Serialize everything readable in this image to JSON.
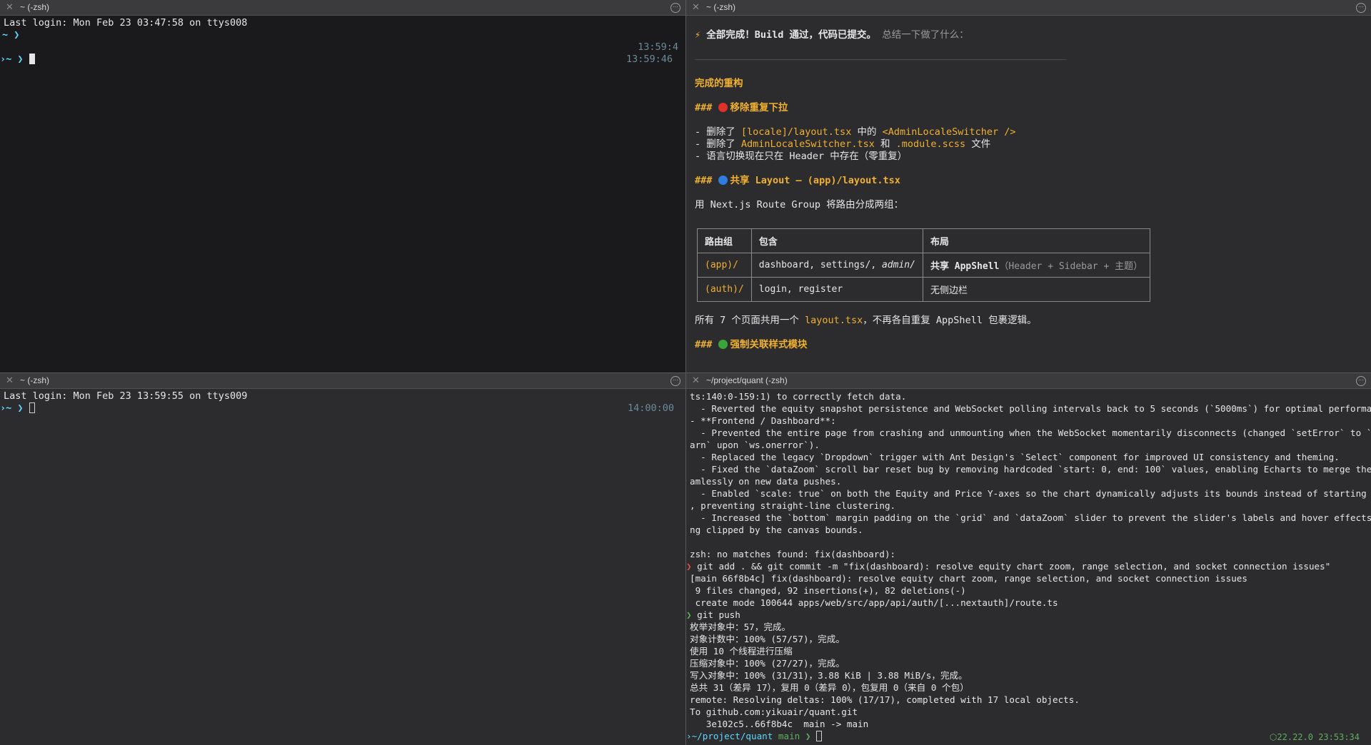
{
  "panes": {
    "top_left": {
      "title": "~ (-zsh)",
      "last_login": "Last login: Mon Feb 23 03:47:58 on ttys008",
      "prompt_symbol": "~ ❯",
      "time1": "13:59:4",
      "time2": "13:59:46",
      "prompt2_prefix": "›~ ❯"
    },
    "top_right": {
      "title": "~ (-zsh)",
      "heading_bolt": "⚡",
      "heading_bold": "全部完成！Build 通过，代码已提交。",
      "heading_rest": " 总结一下做了什么：",
      "section_title": "完成的重构",
      "h1_hash": "###",
      "h1_text": "移除重复下拉",
      "b1_prefix": "- 删除了 ",
      "b1_code1": "[locale]/layout.tsx",
      "b1_mid": " 中的 ",
      "b1_code2": "<AdminLocaleSwitcher />",
      "b2_prefix": "- 删除了 ",
      "b2_code1": "AdminLocaleSwitcher.tsx",
      "b2_mid": " 和 ",
      "b2_code2": ".module.scss",
      "b2_suffix": " 文件",
      "b3": "- 语言切换现在只在 Header 中存在（零重复）",
      "h2_hash": "###",
      "h2_text": "共享 Layout — (app)/layout.tsx",
      "route_intro": "用 Next.js Route Group 将路由分成两组：",
      "table": {
        "headers": [
          "路由组",
          "包含",
          "布局"
        ],
        "rows": [
          {
            "group": "(app)/",
            "contains": "dashboard, settings/, ",
            "contains_italic": "admin/",
            "layout_bold": "共享 AppShell",
            "layout_rest": "（Header + Sidebar + 主题）"
          },
          {
            "group": "(auth)/",
            "contains": "login, register",
            "contains_italic": "",
            "layout_bold": "",
            "layout_rest": "无侧边栏"
          }
        ]
      },
      "summary_prefix": "所有 7 个页面共用一个 ",
      "summary_code": "layout.tsx",
      "summary_suffix": "，不再各自重复 AppShell 包裹逻辑。",
      "h3_hash": "###",
      "h3_text": "强制关联样式模块",
      "dot_colors": {
        "red": "#e0302a",
        "blue": "#2f7de1",
        "green": "#3aa63a"
      }
    },
    "bottom_left": {
      "title": "~ (-zsh)",
      "last_login": "Last login: Mon Feb 23 13:59:55 on ttys009",
      "prompt": "›~ ❯",
      "time": "14:00:00"
    },
    "bottom_right": {
      "title": "~/project/quant (-zsh)",
      "lines": [
        "ts:140:0-159:1) to correctly fetch data.",
        "  - Reverted the equity snapshot persistence and WebSocket polling intervals back to 5 seconds (`5000ms`) for optimal performance.",
        "- **Frontend / Dashboard**:",
        "  - Prevented the entire page from crashing and unmounting when the WebSocket momentarily disconnects (changed `setError` to `console.w",
        "arn` upon `ws.onerror`).",
        "  - Replaced the legacy `Dropdown` trigger with Ant Design's `Select` component for improved UI consistency and theming.",
        "  - Fixed the `dataZoom` scroll bar reset bug by removing hardcoded `start: 0, end: 100` values, enabling Echarts to merge the state se",
        "amlessly on new data pushes.",
        "  - Enabled `scale: true` on both the Equity and Price Y-axes so the chart dynamically adjusts its bounds instead of starting from zero",
        ", preventing straight-line clustering.",
        "  - Increased the `bottom` margin padding on the `grid` and `dataZoom` slider to prevent the slider's labels and hover effects from bei",
        "ng clipped by the canvas bounds.",
        "",
        "zsh: no matches found: fix(dashboard):"
      ],
      "cmd1_prompt": "❯",
      "cmd1": " git add . && git commit -m \"fix(dashboard): resolve equity chart zoom, range selection, and socket connection issues\"",
      "out1": [
        "[main 66f8b4c] fix(dashboard): resolve equity chart zoom, range selection, and socket connection issues",
        " 9 files changed, 92 insertions(+), 82 deletions(-)",
        " create mode 100644 apps/web/src/app/api/auth/[...nextauth]/route.ts"
      ],
      "cmd2_prompt": "❯",
      "cmd2": " git push",
      "out2": [
        "枚举对象中：57，完成。",
        "对象计数中：100% (57/57)，完成。",
        "使用 10 个线程进行压缩",
        "压缩对象中：100% (27/27)，完成。",
        "写入对象中：100% (31/31)，3.88 KiB | 3.88 MiB/s，完成。",
        "总共 31（差异 17），复用 0（差异 0），包复用 0（来自 0 个包）",
        "remote: Resolving deltas: 100% (17/17), completed with 17 local objects.",
        "To github.com:yikuair/quant.git",
        "   3e102c5..66f8b4c  main -> main"
      ],
      "final_path": "›~/project/quant",
      "final_branch": " main ❯",
      "status_right": "⬡22.22.0 23:53:34"
    }
  }
}
